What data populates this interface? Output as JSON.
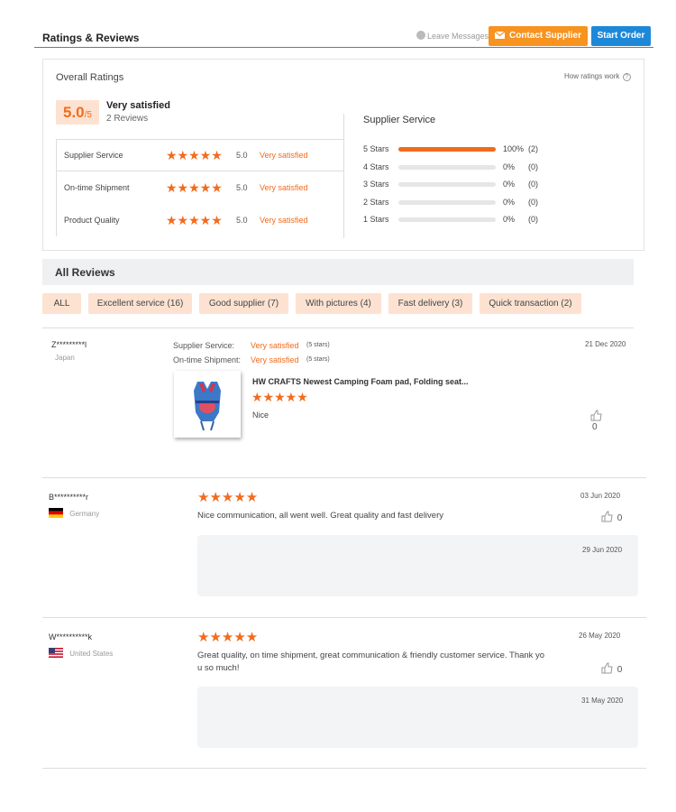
{
  "header": {
    "title": "Ratings & Reviews",
    "leave_messages": "Leave Messages",
    "contact_supplier": "Contact Supplier",
    "start_order": "Start Order"
  },
  "overall": {
    "heading": "Overall Ratings",
    "how_ratings_work": "How ratings work",
    "score": "5.0",
    "score_max": "/5",
    "label": "Very satisfied",
    "reviews_count": "2 Reviews",
    "categories": [
      {
        "name": "Supplier Service",
        "score": "5.0",
        "label": "Very satisfied"
      },
      {
        "name": "On-time Shipment",
        "score": "5.0",
        "label": "Very satisfied"
      },
      {
        "name": "Product Quality",
        "score": "5.0",
        "label": "Very satisfied"
      }
    ]
  },
  "supplier_service": {
    "heading": "Supplier Service",
    "rows": [
      {
        "label": "5 Stars",
        "percent": "100%",
        "count": "(2)",
        "fraction": 1.0
      },
      {
        "label": "4 Stars",
        "percent": "0%",
        "count": "(0)",
        "fraction": 0
      },
      {
        "label": "3 Stars",
        "percent": "0%",
        "count": "(0)",
        "fraction": 0
      },
      {
        "label": "2 Stars",
        "percent": "0%",
        "count": "(0)",
        "fraction": 0
      },
      {
        "label": "1 Stars",
        "percent": "0%",
        "count": "(0)",
        "fraction": 0
      }
    ]
  },
  "all_reviews": {
    "heading": "All Reviews",
    "filters": [
      "ALL",
      "Excellent service (16)",
      "Good supplier (7)",
      "With pictures (4)",
      "Fast delivery (3)",
      "Quick transaction (2)"
    ]
  },
  "reviews": [
    {
      "user": "Z*********l",
      "country": "Japan",
      "date": "21 Dec 2020",
      "service_label": "Supplier Service:",
      "service_value": "Very satisfied",
      "service_stars": "(5 stars)",
      "shipment_label": "On-time Shipment:",
      "shipment_value": "Very satisfied",
      "shipment_stars": "(5 stars)",
      "product_title": "HW CRAFTS Newest Camping Foam pad, Folding seat...",
      "comment": "Nice",
      "likes": "0",
      "rating": 5
    },
    {
      "user": "B**********r",
      "country": "Germany",
      "date": "03 Jun 2020",
      "comment": "Nice communication, all went well. Great quality and fast delivery",
      "likes": "0",
      "reply_date": "29 Jun 2020",
      "rating": 5
    },
    {
      "user": "W**********k",
      "country": "United States",
      "date": "26 May 2020",
      "comment_line1": "Great quality, on time shipment, great communication & friendly customer service. Thank yo",
      "comment_line2": "u so much!",
      "likes": "0",
      "reply_date": "31 May 2020",
      "rating": 5
    }
  ],
  "colors": {
    "accent": "#f26b1d",
    "contact_button": "#f7931e",
    "start_button": "#1e88d8"
  },
  "stars_glyph": "★★★★★"
}
